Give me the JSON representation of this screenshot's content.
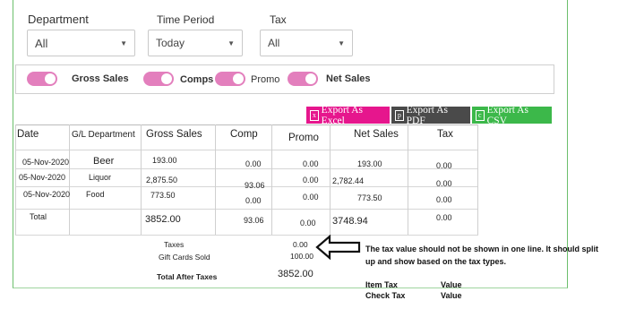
{
  "filters": {
    "department": {
      "label": "Department",
      "value": "All"
    },
    "period": {
      "label": "Time Period",
      "value": "Today"
    },
    "tax": {
      "label": "Tax",
      "value": "All"
    }
  },
  "toggles": [
    {
      "label": "Gross Sales"
    },
    {
      "label": "Comps"
    },
    {
      "label": "Promo"
    },
    {
      "label": "Net Sales"
    }
  ],
  "exports": {
    "excel": {
      "label": "Export As Excel",
      "color": "#e6168d"
    },
    "pdf": {
      "label": "Export As PDF",
      "color": "#4a4a4a"
    },
    "csv": {
      "label": "Export As CSV",
      "color": "#3cb84a"
    }
  },
  "table": {
    "headers": [
      "Date",
      "G/L Department",
      "Gross Sales",
      "Comp",
      "Promo",
      "Net Sales",
      "Tax"
    ],
    "rows": [
      {
        "date": "05-Nov-2020",
        "dept": "Beer",
        "gross": "193.00",
        "comp": "0.00",
        "promo": "0.00",
        "net": "193.00",
        "tax": "0.00"
      },
      {
        "date": "05-Nov-2020",
        "dept": "Liquor",
        "gross": "2,875.50",
        "comp": "93.06",
        "promo": "0.00",
        "net": "2,782.44",
        "tax": "0.00"
      },
      {
        "date": "05-Nov-2020",
        "dept": "Food",
        "gross": "773.50",
        "comp": "0.00",
        "promo": "0.00",
        "net": "773.50",
        "tax": "0.00"
      }
    ],
    "total": {
      "label": "Total",
      "gross": "3852.00",
      "comp": "93.06",
      "promo": "0.00",
      "net": "3748.94",
      "tax": "0.00"
    }
  },
  "summary": {
    "taxes_label": "Taxes",
    "taxes_value": "0.00",
    "gift_label": "Gift Cards Sold",
    "gift_value": "100.00",
    "after_label": "Total After Taxes",
    "after_value": "3852.00"
  },
  "annotation": {
    "line1": "The tax value should not be shown in one line. It should split",
    "line2": "up and show based on the tax types.",
    "item_tax": "Item Tax",
    "check_tax": "Check Tax",
    "value1": "Value",
    "value2": "Value"
  }
}
